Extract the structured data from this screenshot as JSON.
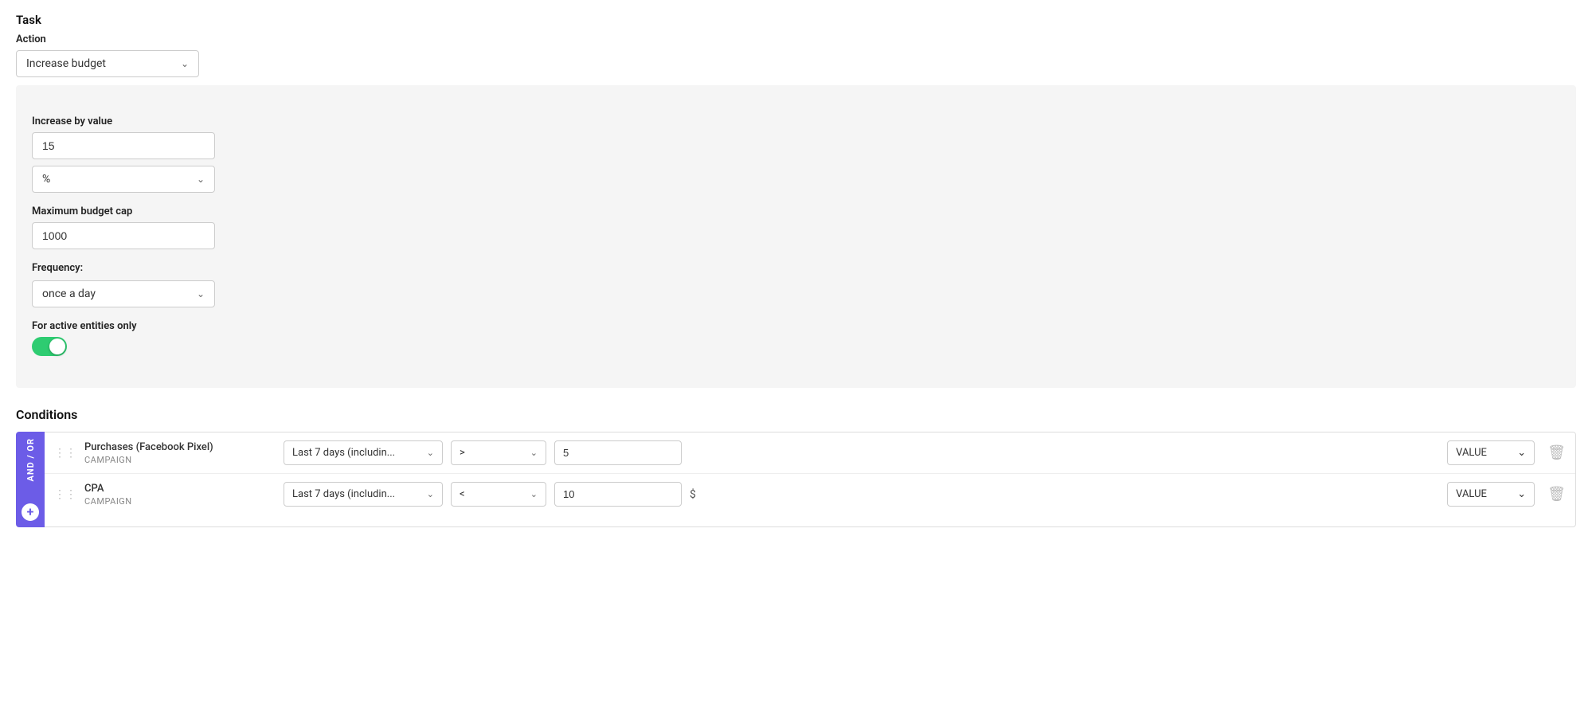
{
  "page": {
    "task_section_title": "Task",
    "action_label": "Action",
    "action_value": "Increase budget",
    "task_card": {
      "increase_by_value_label": "Increase by value",
      "increase_by_value_input": "15",
      "increase_by_value_input_placeholder": "",
      "percent_select_value": "%",
      "maximum_budget_cap_label": "Maximum budget cap",
      "maximum_budget_cap_input": "1000",
      "maximum_budget_cap_placeholder": "",
      "frequency_label": "Frequency:",
      "frequency_value": "once a day",
      "active_entities_label": "For active entities only",
      "toggle_on": true
    },
    "conditions_section": {
      "title": "Conditions",
      "and_or_label": "AND / OR",
      "add_button": "+",
      "rows": [
        {
          "drag_icon": "⋮⋮",
          "name": "Purchases (Facebook Pixel)",
          "sub": "CAMPAIGN",
          "period": "Last 7 days (includin...",
          "operator": ">",
          "value": "5",
          "currency": "",
          "value_type": "VALUE"
        },
        {
          "drag_icon": "⋮⋮",
          "name": "CPA",
          "sub": "CAMPAIGN",
          "period": "Last 7 days (includin...",
          "operator": "<",
          "value": "10",
          "currency": "$",
          "value_type": "VALUE"
        }
      ]
    }
  }
}
